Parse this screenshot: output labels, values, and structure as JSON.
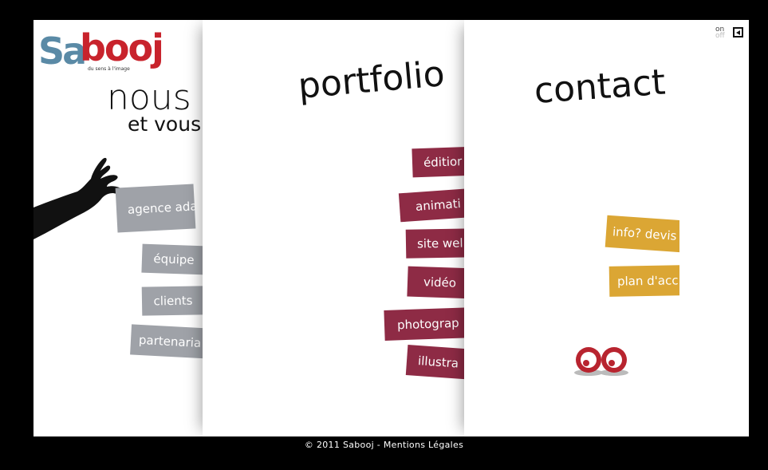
{
  "logo": {
    "part1": "Sa",
    "part2": "booj",
    "tagline": "du sens à l'image"
  },
  "sound": {
    "on": "on",
    "off": "off",
    "icon": "sound-toggle-icon"
  },
  "sections": {
    "nous": {
      "title": "nous",
      "subtitle": "et vous",
      "items": [
        "agence adaptée",
        "équipe",
        "clients",
        "partenaria"
      ]
    },
    "portfolio": {
      "title": "portfolio",
      "items": [
        "éditior",
        "animati",
        "site wel",
        "vidéo",
        "photograp",
        "illustra"
      ]
    },
    "contact": {
      "title": "contact",
      "items": [
        "info? devis",
        "plan d'acc"
      ]
    }
  },
  "footer": {
    "text": "© 2011 Sabooj - Mentions Légales"
  },
  "colors": {
    "grey": "#9fa2a8",
    "red": "#8e2b45",
    "gold": "#dba634",
    "logo_blue": "#5a8aa6",
    "logo_red": "#c8232c"
  }
}
